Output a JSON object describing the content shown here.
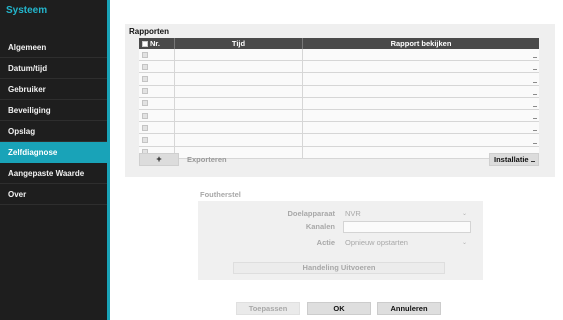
{
  "sidebar": {
    "title": "Systeem",
    "items": [
      {
        "label": "Algemeen"
      },
      {
        "label": "Datum/tijd"
      },
      {
        "label": "Gebruiker"
      },
      {
        "label": "Beveiliging"
      },
      {
        "label": "Opslag"
      },
      {
        "label": "Zelfdiagnose",
        "active": true
      },
      {
        "label": "Aangepaste Waarde"
      },
      {
        "label": "Over"
      }
    ],
    "accent_color": "#19a3b8"
  },
  "reports": {
    "title": "Rapporten",
    "columns": {
      "nr": "Nr.",
      "time": "Tijd",
      "view": "Rapport bekijken"
    },
    "rows": [
      "",
      "",
      "",
      "",
      "",
      "",
      "",
      "",
      ""
    ],
    "add_label": "+",
    "export_label": "Exporteren",
    "install_label": "Installatie"
  },
  "factory_reset": {
    "title": "Foutherstel",
    "target_label": "Doelapparaat",
    "target_value": "NVR",
    "channels_label": "Kanalen",
    "channels_value": "",
    "action_label": "Actie",
    "action_value": "Opnieuw opstarten",
    "execute_label": "Handeling Uitvoeren"
  },
  "footer": {
    "apply_label": "Toepassen",
    "ok_label": "OK",
    "cancel_label": "Annuleren"
  }
}
